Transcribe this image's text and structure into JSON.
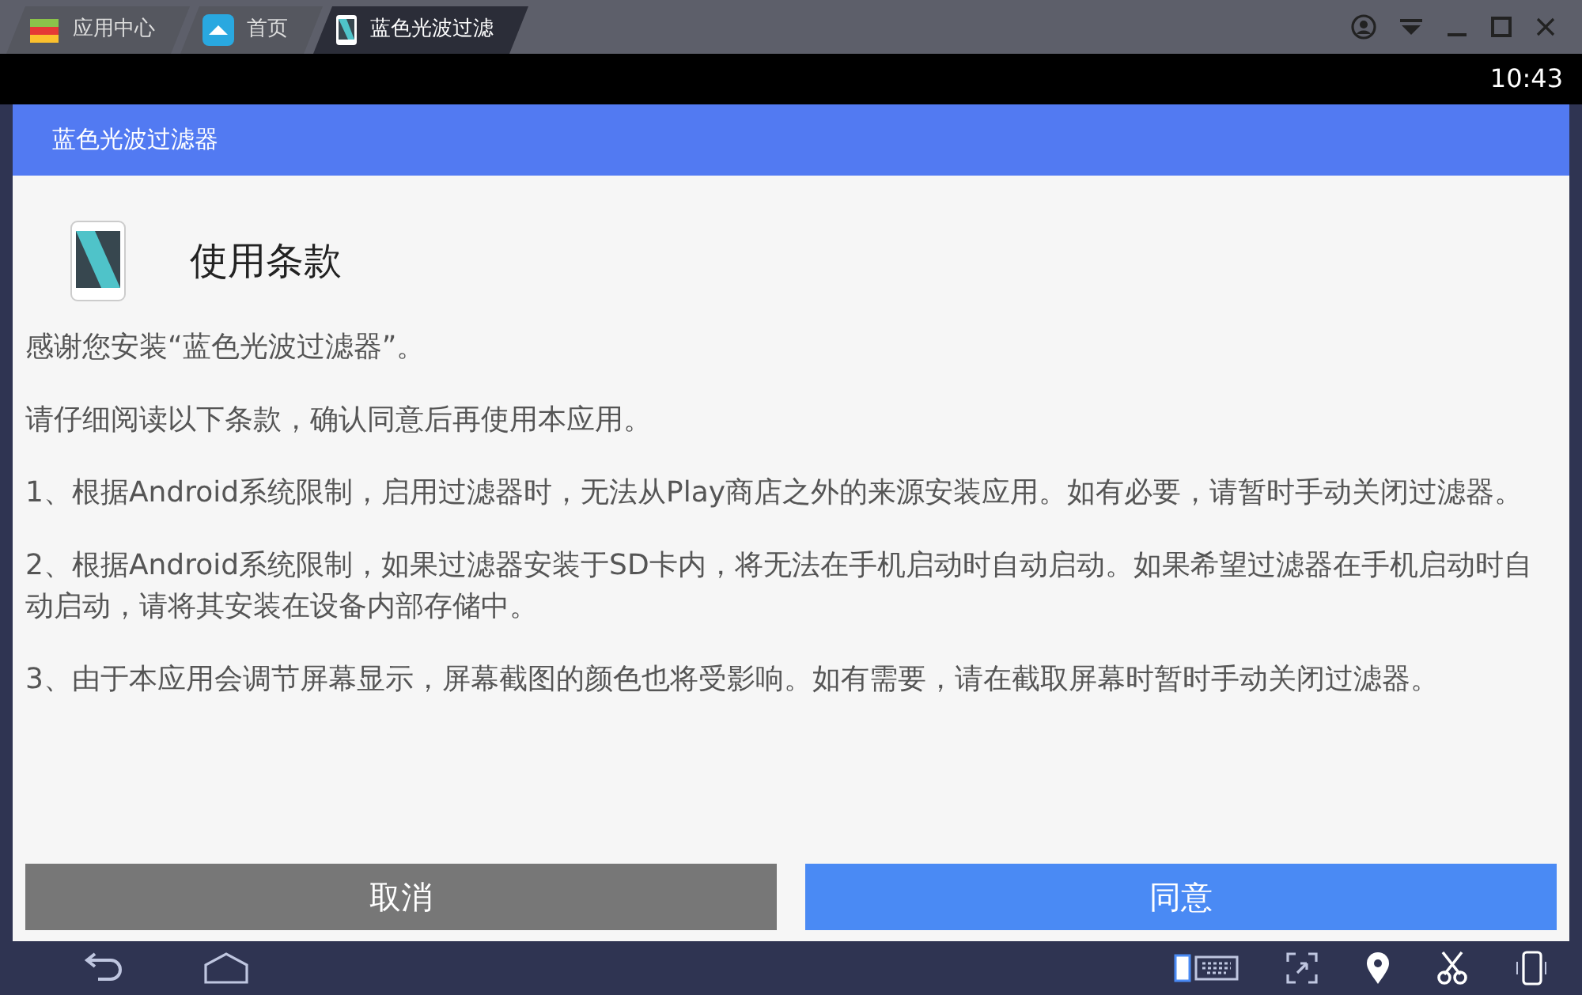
{
  "tabs": [
    {
      "label": "应用中心",
      "kind": "store",
      "selected": false
    },
    {
      "label": "首页",
      "kind": "home",
      "selected": false
    },
    {
      "label": "蓝色光波过滤",
      "kind": "app",
      "selected": true
    }
  ],
  "status_bar": {
    "time": "10:43"
  },
  "app_bar": {
    "title": "蓝色光波过滤器"
  },
  "dialog": {
    "title": "使用条款",
    "paragraphs": [
      "感谢您安装“蓝色光波过滤器”。",
      "请仔细阅读以下条款，确认同意后再使用本应用。",
      "1、根据Android系统限制，启用过滤器时，无法从Play商店之外的来源安装应用。如有必要，请暂时手动关闭过滤器。",
      "2、根据Android系统限制，如果过滤器安装于SD卡内，将无法在手机启动时自动启动。如果希望过滤器在手机启动时自动启动，请将其安装在设备内部存储中。",
      "3、由于本应用会调节屏幕显示，屏幕截图的颜色也将受影响。如有需要，请在截取屏幕时暂时手动关闭过滤器。"
    ],
    "buttons": [
      {
        "label": "取消",
        "kind": "cancel"
      },
      {
        "label": "同意",
        "kind": "agree"
      }
    ]
  }
}
